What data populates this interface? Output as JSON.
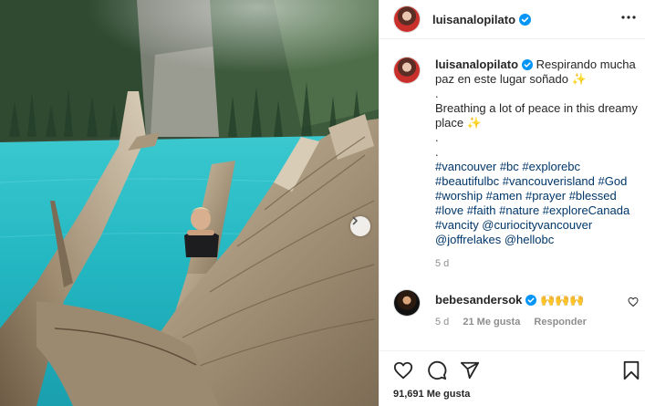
{
  "post": {
    "username": "luisanalopilato",
    "caption_es": "Respirando mucha paz en este lugar soñado",
    "caption_en": "Breathing a lot of peace in this dreamy place",
    "sparkle_emoji": "✨",
    "dot": ".",
    "hashtags": "#vancouver #bc #explorebc #beautifulbc #vancouverisland #God #worship #amen #prayer #blessed #love #faith #nature #exploreCanada #vancity @curiocityvancouver @joffrelakes @hellobc",
    "time": "5 d",
    "likes": "91,691 Me gusta"
  },
  "comment": {
    "username": "bebesandersok",
    "text": "🙌🙌🙌",
    "time": "5 d",
    "likes": "21 Me gusta",
    "reply_label": "Responder"
  },
  "icons": {
    "verified": "verified-badge-icon",
    "more": "more-options-icon",
    "like": "heart-icon",
    "comment": "comment-bubble-icon",
    "share": "paper-plane-icon",
    "save": "bookmark-icon",
    "carousel": "chevron-right-icon"
  },
  "colors": {
    "link": "#00376b",
    "verified": "#0095f6",
    "muted": "#8e8e8e",
    "lake": "#2bc3cc"
  }
}
